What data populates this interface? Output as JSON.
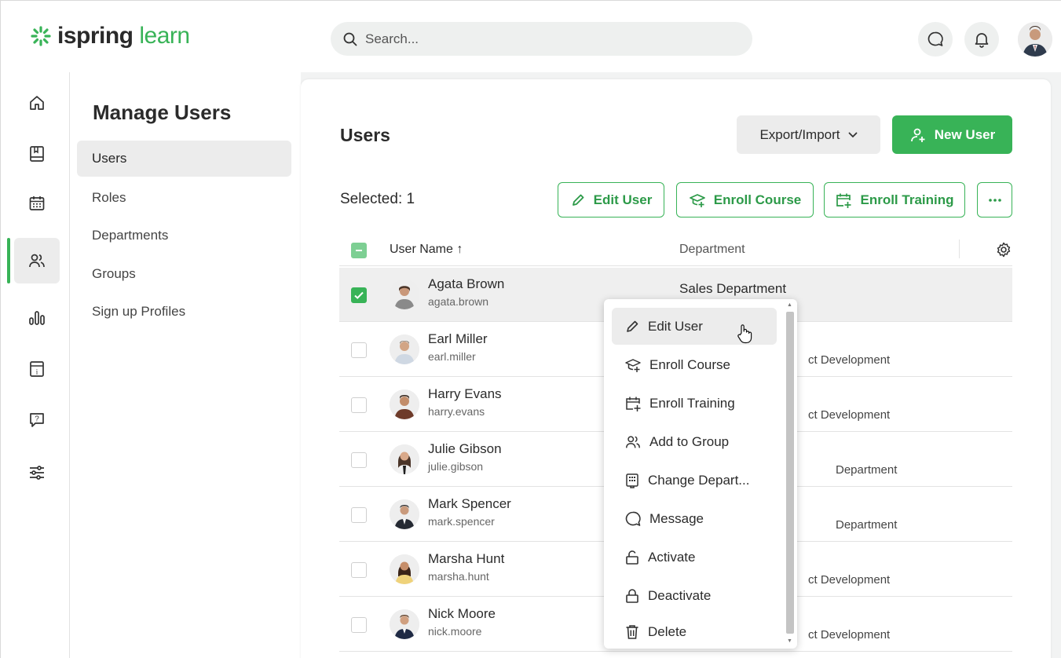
{
  "app": {
    "logo_bold": "ispring",
    "logo_light": "learn",
    "brand_color": "#38b357"
  },
  "search": {
    "placeholder": "Search..."
  },
  "top_icons": [
    "message-icon",
    "bell-icon",
    "user-avatar"
  ],
  "rail": {
    "items": [
      "home-icon",
      "book-icon",
      "calendar-icon",
      "users-icon",
      "reports-icon",
      "info-icon",
      "help-icon",
      "settings-icon"
    ],
    "active": "users-icon"
  },
  "subnav": {
    "title": "Manage Users",
    "items": [
      {
        "label": "Users",
        "active": true
      },
      {
        "label": "Roles"
      },
      {
        "label": "Departments"
      },
      {
        "label": "Groups"
      },
      {
        "label": "Sign up Profiles"
      }
    ]
  },
  "main": {
    "title": "Users",
    "export_label": "Export/Import",
    "new_user_label": "New User",
    "selected_label": "Selected: 1",
    "actions": {
      "edit_user": "Edit User",
      "enroll_course": "Enroll Course",
      "enroll_training": "Enroll Training",
      "more": "..."
    },
    "columns": {
      "name": "User Name",
      "sort_arrow": "↑",
      "department": "Department"
    },
    "rows": [
      {
        "name": "Agata Brown",
        "login": "agata.brown",
        "department": "Sales Department",
        "checked": true
      },
      {
        "name": "Earl Miller",
        "login": "earl.miller",
        "department": "ct Development",
        "checked": false
      },
      {
        "name": "Harry Evans",
        "login": "harry.evans",
        "department": "ct Development",
        "checked": false
      },
      {
        "name": "Julie Gibson",
        "login": "julie.gibson",
        "department": "Department",
        "checked": false
      },
      {
        "name": "Mark Spencer",
        "login": "mark.spencer",
        "department": "Department",
        "checked": false
      },
      {
        "name": "Marsha Hunt",
        "login": "marsha.hunt",
        "department": "ct Development",
        "checked": false
      },
      {
        "name": "Nick Moore",
        "login": "nick.moore",
        "department": "ct Development",
        "checked": false
      }
    ]
  },
  "context_menu": {
    "items": [
      {
        "label": "Edit User",
        "icon": "pencil-icon",
        "hover": true
      },
      {
        "label": "Enroll Course",
        "icon": "enroll-course-icon"
      },
      {
        "label": "Enroll Training",
        "icon": "enroll-training-icon"
      },
      {
        "label": "Add to Group",
        "icon": "users-icon"
      },
      {
        "label": "Change Depart...",
        "icon": "building-icon"
      },
      {
        "label": "Message",
        "icon": "message-icon"
      },
      {
        "label": "Activate",
        "icon": "unlock-icon"
      },
      {
        "label": "Deactivate",
        "icon": "lock-icon"
      },
      {
        "label": "Delete",
        "icon": "trash-icon"
      }
    ]
  }
}
